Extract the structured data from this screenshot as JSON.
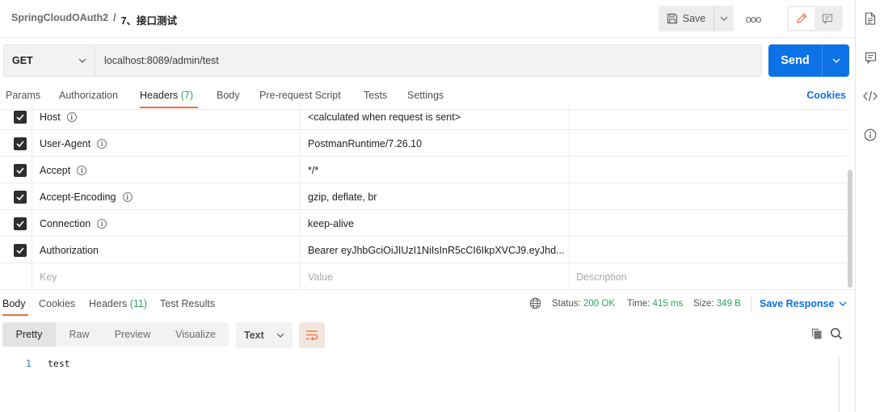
{
  "breadcrumb": {
    "parent": "SpringCloudOAuth2",
    "separator": "/",
    "current": "7、接口测试"
  },
  "toolbar": {
    "save_label": "Save",
    "more_label": "ooo"
  },
  "request": {
    "method": "GET",
    "url": "localhost:8089/admin/test",
    "send_label": "Send"
  },
  "request_tabs": [
    {
      "label": "Params"
    },
    {
      "label": "Authorization"
    },
    {
      "label": "Headers",
      "count": "(7)"
    },
    {
      "label": "Body"
    },
    {
      "label": "Pre-request Script"
    },
    {
      "label": "Tests"
    },
    {
      "label": "Settings"
    }
  ],
  "cookies_label": "Cookies",
  "headers": [
    {
      "key": "Host",
      "value": "<calculated when request is sent>",
      "checked": true,
      "info": true
    },
    {
      "key": "User-Agent",
      "value": "PostmanRuntime/7.26.10",
      "checked": true,
      "info": true
    },
    {
      "key": "Accept",
      "value": "*/*",
      "checked": true,
      "info": true
    },
    {
      "key": "Accept-Encoding",
      "value": "gzip, deflate, br",
      "checked": true,
      "info": true
    },
    {
      "key": "Connection",
      "value": "keep-alive",
      "checked": true,
      "info": true
    },
    {
      "key": "Authorization",
      "value": "Bearer eyJhbGciOiJIUzI1NiIsInR5cCI6IkpXVCJ9.eyJhd...",
      "checked": true,
      "info": false
    }
  ],
  "headers_placeholder": {
    "key": "Key",
    "value": "Value",
    "description": "Description"
  },
  "response_tabs": [
    {
      "label": "Body"
    },
    {
      "label": "Cookies"
    },
    {
      "label": "Headers",
      "count": "(11)"
    },
    {
      "label": "Test Results"
    }
  ],
  "status": {
    "status_label": "Status:",
    "status_value": "200 OK",
    "time_label": "Time:",
    "time_value": "415 ms",
    "size_label": "Size:",
    "size_value": "349 B"
  },
  "save_response_label": "Save Response",
  "format_tabs": [
    "Pretty",
    "Raw",
    "Preview",
    "Visualize"
  ],
  "language": "Text",
  "response_body": {
    "line_number": "1",
    "text": "test"
  },
  "colors": {
    "accent": "#f26b3a",
    "primary": "#0c72e5",
    "success": "#26a65b"
  }
}
